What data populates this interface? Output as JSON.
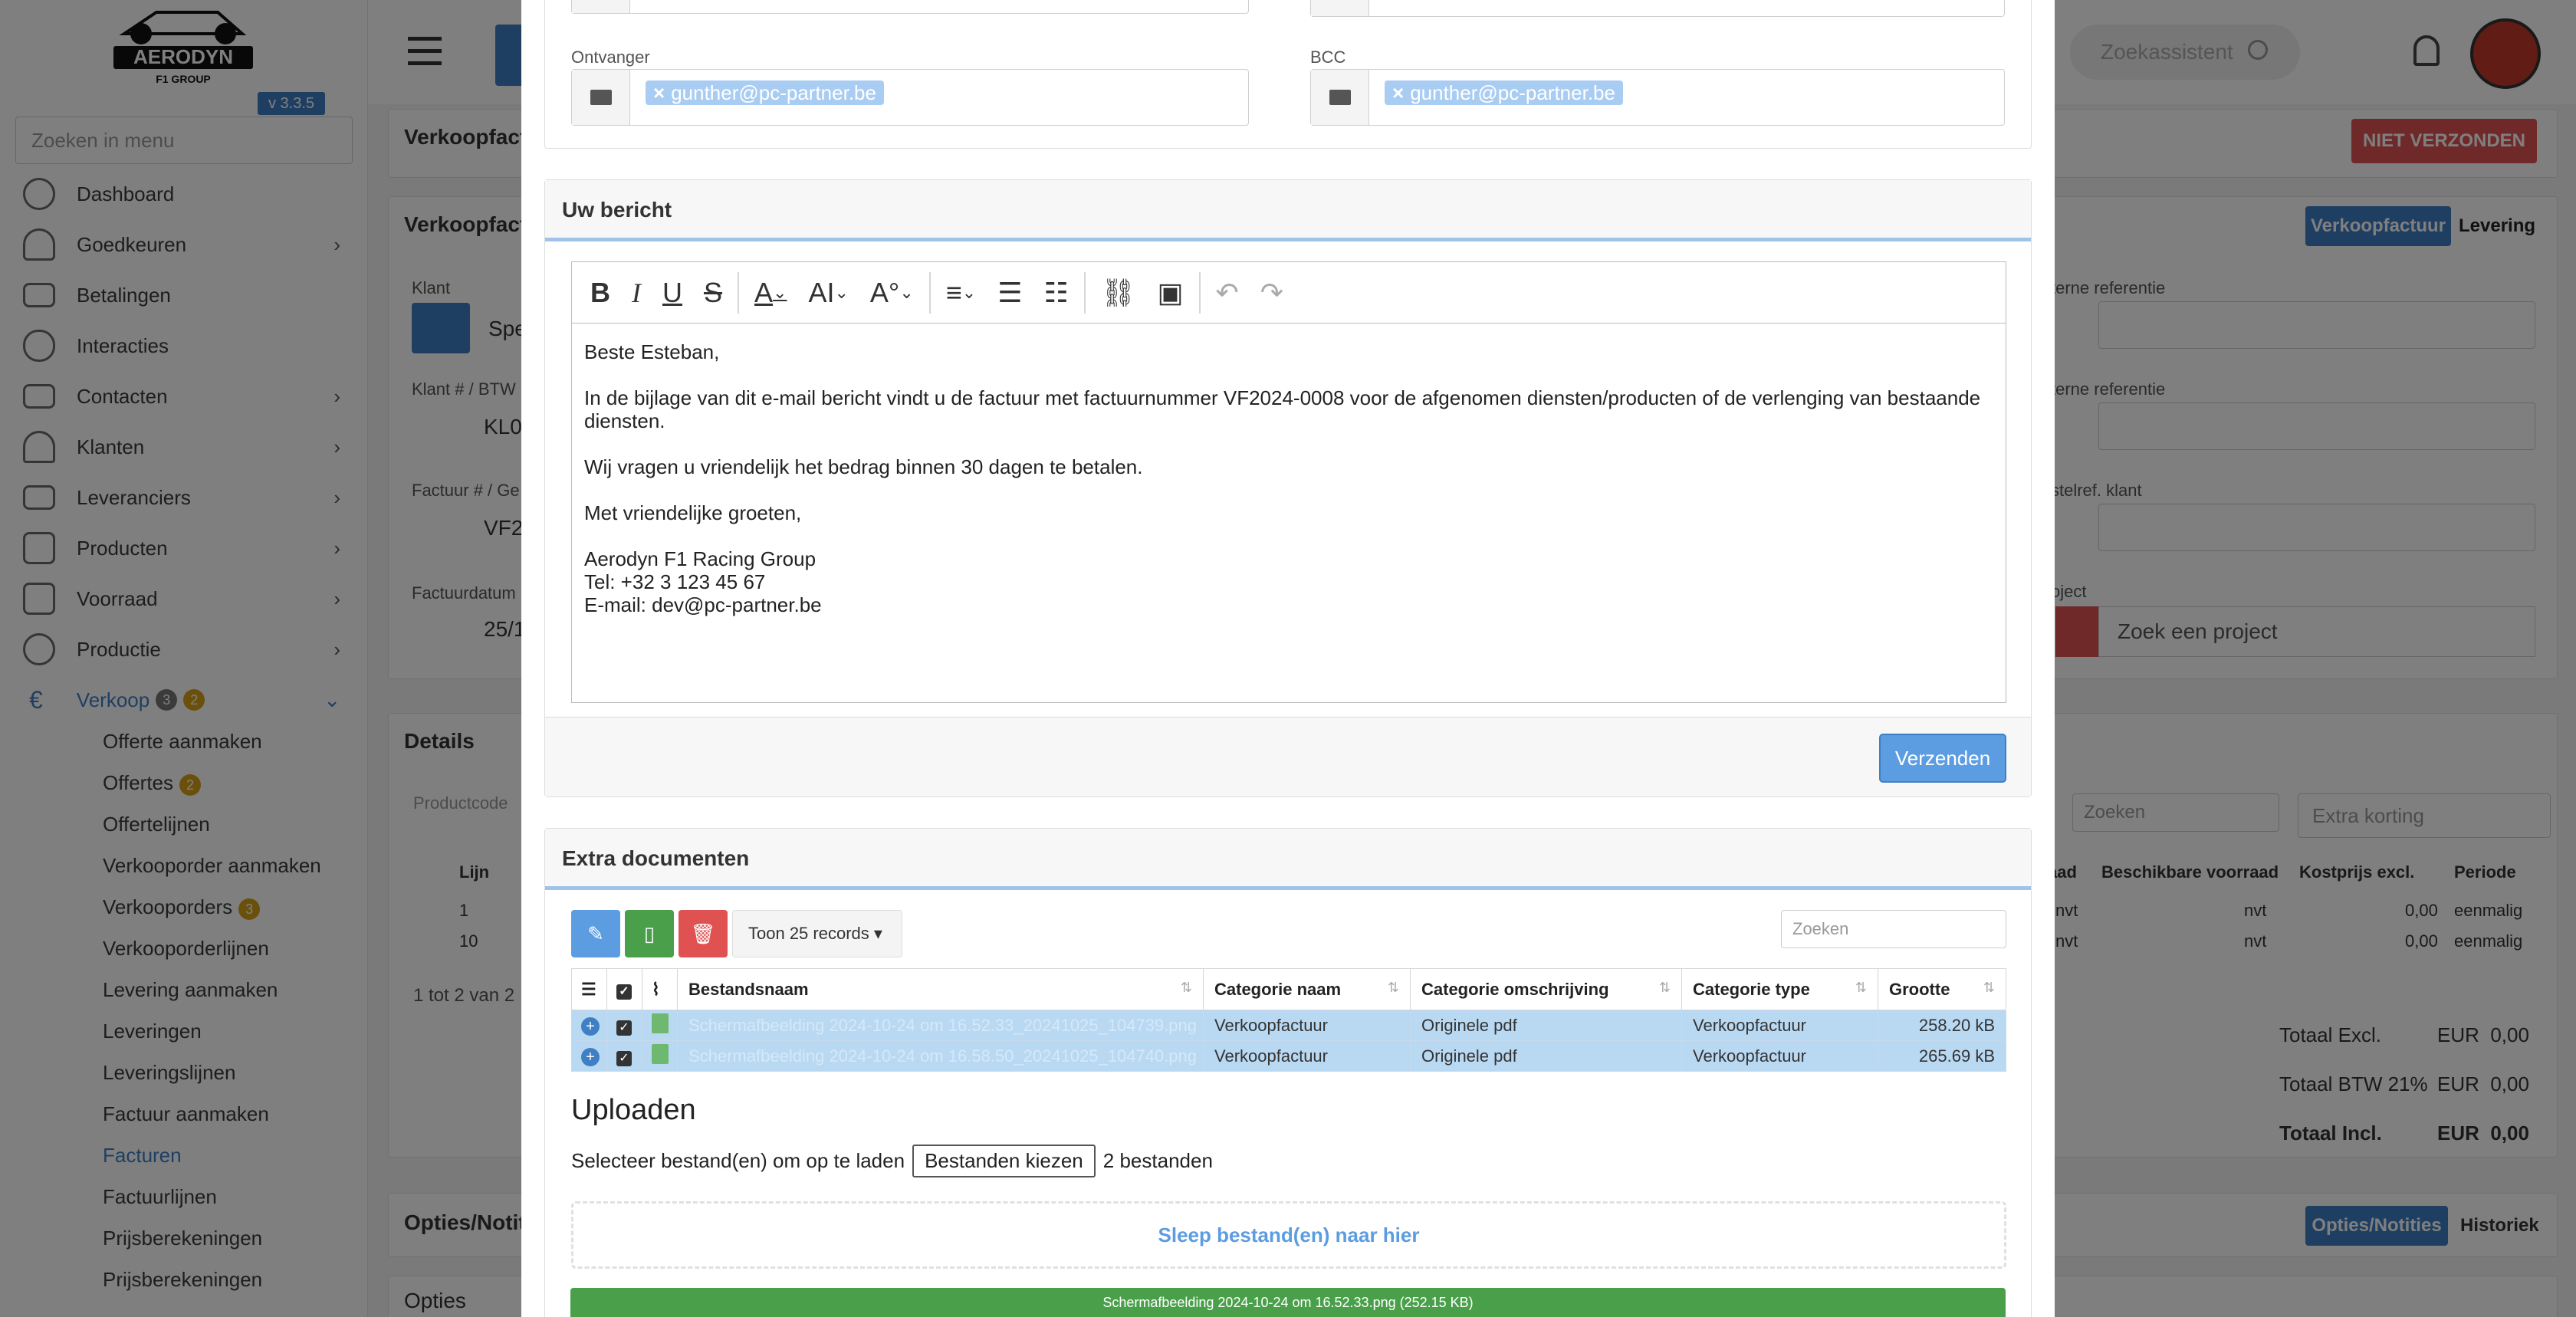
{
  "app": {
    "logo_text": "AERODYN",
    "logo_sub": "F1 GROUP",
    "version": "v 3.3.5",
    "menu_search_placeholder": "Zoeken in menu"
  },
  "sidebar": {
    "items": [
      {
        "label": "Dashboard",
        "chevron": false
      },
      {
        "label": "Goedkeuren",
        "chevron": true
      },
      {
        "label": "Betalingen",
        "chevron": false
      },
      {
        "label": "Interacties",
        "chevron": false
      },
      {
        "label": "Contacten",
        "chevron": true
      },
      {
        "label": "Klanten",
        "chevron": true
      },
      {
        "label": "Leveranciers",
        "chevron": true
      },
      {
        "label": "Producten",
        "chevron": true
      },
      {
        "label": "Voorraad",
        "chevron": true
      },
      {
        "label": "Productie",
        "chevron": true
      }
    ],
    "active": {
      "label": "Verkoop",
      "badge1": "3",
      "badge2": "2"
    },
    "subitems": [
      {
        "label": "Offerte aanmaken"
      },
      {
        "label": "Offertes",
        "badge": "2"
      },
      {
        "label": "Offertelijnen"
      },
      {
        "label": "Verkooporder aanmaken"
      },
      {
        "label": "Verkooporders",
        "badge": "3"
      },
      {
        "label": "Verkooporderlijnen"
      },
      {
        "label": "Levering aanmaken"
      },
      {
        "label": "Leveringen"
      },
      {
        "label": "Leveringslijnen"
      },
      {
        "label": "Factuur aanmaken"
      },
      {
        "label": "Facturen",
        "active": true
      },
      {
        "label": "Factuurlijnen"
      },
      {
        "label": "Prijsberekeningen"
      },
      {
        "label": "Prijsberekeningen"
      }
    ]
  },
  "topbar": {
    "search_placeholder": "Zoekassistent"
  },
  "background": {
    "title1": "Verkoopfact",
    "title2": "Verkoopfact",
    "status_btn": "NIET VERZONDEN",
    "tab_active": "Verkoopfactuur",
    "tab2": "Levering",
    "lbl_klant": "Klant",
    "val_klant": "Spe",
    "lbl_btw": "Klant # / BTW",
    "val_btw": "KL0",
    "lbl_factuur": "Factuur # / Ge",
    "val_factuur": "VF20",
    "lbl_datum": "Factuurdatum",
    "val_datum": "25/1",
    "lbl_ref1": "terne referentie",
    "lbl_ref2": "terne referentie",
    "lbl_ref3": "stelref. klant",
    "lbl_project": "oject",
    "project_placeholder": "Zoek een project",
    "details": "Details",
    "productcode": "Productcode",
    "search": "Zoeken",
    "extra_korting": "Extra korting",
    "col_lijn": "Lijn",
    "col_vrd": "aad",
    "col_beschikbaar": "Beschikbare voorraad",
    "col_kostprijs": "Kostprijs excl.",
    "col_periode": "Periode",
    "rows": [
      {
        "lijn": "1",
        "a": "nvt",
        "b": "nvt",
        "c": "0,00",
        "d": "eenmalig"
      },
      {
        "lijn": "10",
        "a": "nvt",
        "b": "nvt",
        "c": "0,00",
        "d": "eenmalig"
      }
    ],
    "count": "1 tot 2 van 2",
    "tot_excl_l": "Totaal Excl.",
    "tot_excl_v": "EUR  0,00",
    "tot_btw_l": "Totaal BTW 21%",
    "tot_btw_v": "EUR  0,00",
    "tot_incl_l": "Totaal Incl.",
    "tot_incl_v": "EUR  0,00",
    "opties_title": "Opties/Notiti",
    "opties_tab": "Opties/Notities",
    "historiek_tab": "Historiek",
    "opties": "Opties"
  },
  "modal": {
    "ontvanger_label": "Ontvanger",
    "ontvanger_value": "gunther@pc-partner.be",
    "bcc_label": "BCC",
    "bcc_value": "gunther@pc-partner.be",
    "bericht_title": "Uw bericht",
    "message": {
      "greeting": "Beste Esteban,",
      "body1": "In de bijlage van dit e-mail bericht vindt u de factuur met factuurnummer VF2024-0008 voor de afgenomen diensten/producten of de verlenging van bestaande diensten.",
      "body2": "Wij vragen u vriendelijk het bedrag binnen 30 dagen te betalen.",
      "closing": "Met vriendelijke groeten,",
      "sig1": "Aerodyn F1 Racing Group",
      "sig2": "Tel: +32 3 123 45 67",
      "sig3": "E-mail: dev@pc-partner.be"
    },
    "send_label": "Verzenden",
    "extra_title": "Extra documenten",
    "toon": "Toon 25 records",
    "search_placeholder": "Zoeken",
    "cols": {
      "naam": "Bestandsnaam",
      "cat": "Categorie naam",
      "oms": "Categorie omschrijving",
      "type": "Categorie type",
      "grootte": "Grootte"
    },
    "files": [
      {
        "naam": "Schermafbeelding 2024-10-24 om 16.52.33_20241025_104739.png",
        "cat": "Verkoopfactuur",
        "oms": "Originele pdf",
        "type": "Verkoopfactuur",
        "grootte": "258.20 kB"
      },
      {
        "naam": "Schermafbeelding 2024-10-24 om 16.58.50_20241025_104740.png",
        "cat": "Verkoopfactuur",
        "oms": "Originele pdf",
        "type": "Verkoopfactuur",
        "grootte": "265.69 kB"
      }
    ],
    "upload_title": "Uploaden",
    "select_text": "Selecteer bestand(en) om op te laden",
    "choose_btn": "Bestanden kiezen",
    "chosen_text": "2 bestanden",
    "drop_text": "Sleep bestand(en) naar hier",
    "progress_text": "Schermafbeelding 2024-10-24 om 16.52.33.png (252.15 KB)",
    "progress_percent": 100
  },
  "colors": {
    "primary": "#3f7fc4",
    "danger": "#e05252",
    "success": "#4aa04a",
    "badge": "#d4a017"
  }
}
